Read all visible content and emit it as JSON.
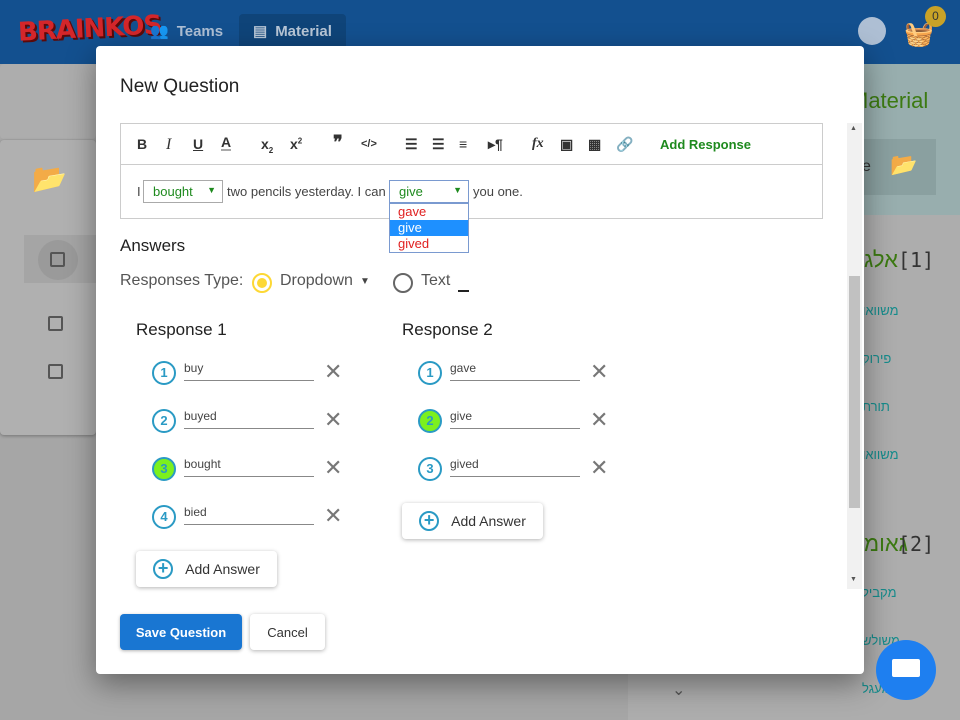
{
  "header": {
    "logo": "BRAINKOS",
    "nav": [
      {
        "label": "Teams",
        "icon": "people-icon"
      },
      {
        "label": "Material",
        "icon": "library-icon",
        "active": true
      }
    ],
    "cart_count": "0"
  },
  "background": {
    "right_title": "Material",
    "right_button_partial": "e",
    "sections": [
      {
        "title": "אלג",
        "index": "[1]",
        "items": [
          "משוואו",
          "פירוק",
          "תורת",
          "משוואו"
        ]
      },
      {
        "title": "גאומ",
        "index": "[2]",
        "items": [
          "מקביל",
          "משולש",
          "מעגל"
        ]
      }
    ]
  },
  "modal": {
    "title": "New Question",
    "toolbar": {
      "add_response": "Add Response"
    },
    "editor": {
      "t1": "I",
      "sel1": "bought",
      "t2": "two pencils yesterday. I can",
      "sel2": "give",
      "t3": "you one.",
      "options": [
        "gave",
        "give",
        "gived"
      ],
      "highlighted": "give"
    },
    "answers_title": "Answers",
    "responses_type_label": "Responses Type:",
    "type_dropdown": "Dropdown",
    "type_text": "Text",
    "selected_type": "Dropdown",
    "responses": [
      {
        "title": "Response 1",
        "answers": [
          {
            "n": "1",
            "v": "buy"
          },
          {
            "n": "2",
            "v": "buyed"
          },
          {
            "n": "3",
            "v": "bought",
            "correct": true
          },
          {
            "n": "4",
            "v": "bied"
          }
        ]
      },
      {
        "title": "Response 2",
        "answers": [
          {
            "n": "1",
            "v": "gave"
          },
          {
            "n": "2",
            "v": "give",
            "correct": true
          },
          {
            "n": "3",
            "v": "gived"
          }
        ]
      }
    ],
    "add_answer": "Add Answer",
    "save": "Save Question",
    "cancel": "Cancel"
  },
  "colors": {
    "header": "#13508f",
    "primary": "#1976d2",
    "correct": "#7cf01e",
    "accent": "#2a9ac4",
    "selected_radio": "#fdd835"
  }
}
